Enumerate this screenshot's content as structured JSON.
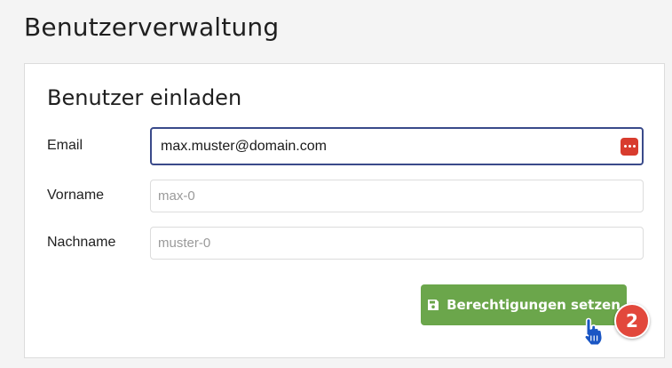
{
  "page": {
    "title": "Benutzerverwaltung"
  },
  "card": {
    "title": "Benutzer einladen",
    "fields": {
      "email": {
        "label": "Email",
        "value": "max.muster@domain.com"
      },
      "firstname": {
        "label": "Vorname",
        "placeholder": "max-0"
      },
      "lastname": {
        "label": "Nachname",
        "placeholder": "muster-0"
      }
    },
    "save_button": {
      "label": "Berechtigungen setzen",
      "icon": "save-icon"
    }
  },
  "step_badge": {
    "number": "2"
  },
  "colors": {
    "button": "#6ba64b",
    "badge": "#e2483c",
    "focus_border": "#3a4a8a",
    "password_icon": "#d83c2e",
    "cursor": "#1a56c4"
  },
  "icons": [
    "save-icon",
    "password-manager-icon",
    "hand-pointer-cursor-icon"
  ]
}
